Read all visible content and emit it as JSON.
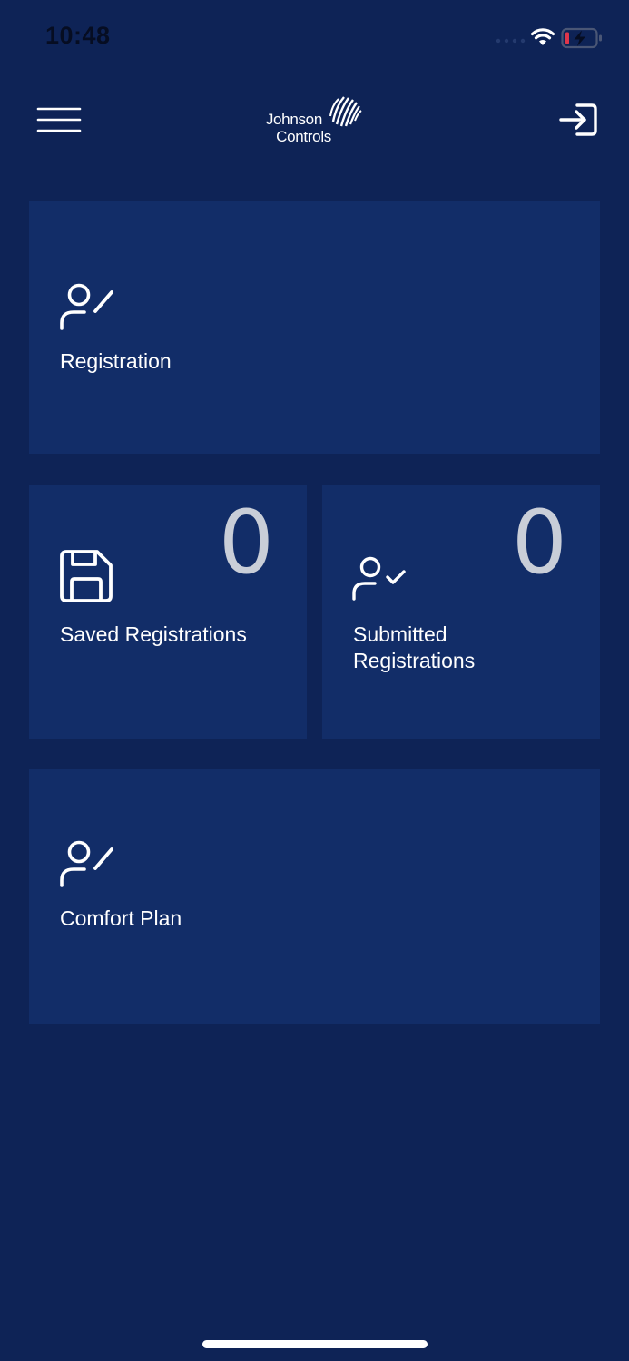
{
  "status_bar": {
    "time": "10:48"
  },
  "header": {
    "logo_line1": "Johnson",
    "logo_line2": "Controls",
    "menu_icon": "hamburger-menu-icon",
    "signin_icon": "sign-in-arrow-icon"
  },
  "tiles": {
    "registration": {
      "label": "Registration",
      "icon": "user-edit-icon"
    },
    "saved": {
      "label": "Saved Registrations",
      "count": "0",
      "icon": "floppy-disk-icon"
    },
    "submitted": {
      "label_line1": "Submitted",
      "label_line2": "Registrations",
      "count": "0",
      "icon": "user-check-icon"
    },
    "comfort_plan": {
      "label": "Comfort Plan",
      "icon": "user-edit-icon"
    }
  },
  "colors": {
    "background": "#0e2356",
    "tile": "#122d68",
    "text": "#ffffff",
    "count": "#c9ced8",
    "battery_low": "#e0364a"
  }
}
